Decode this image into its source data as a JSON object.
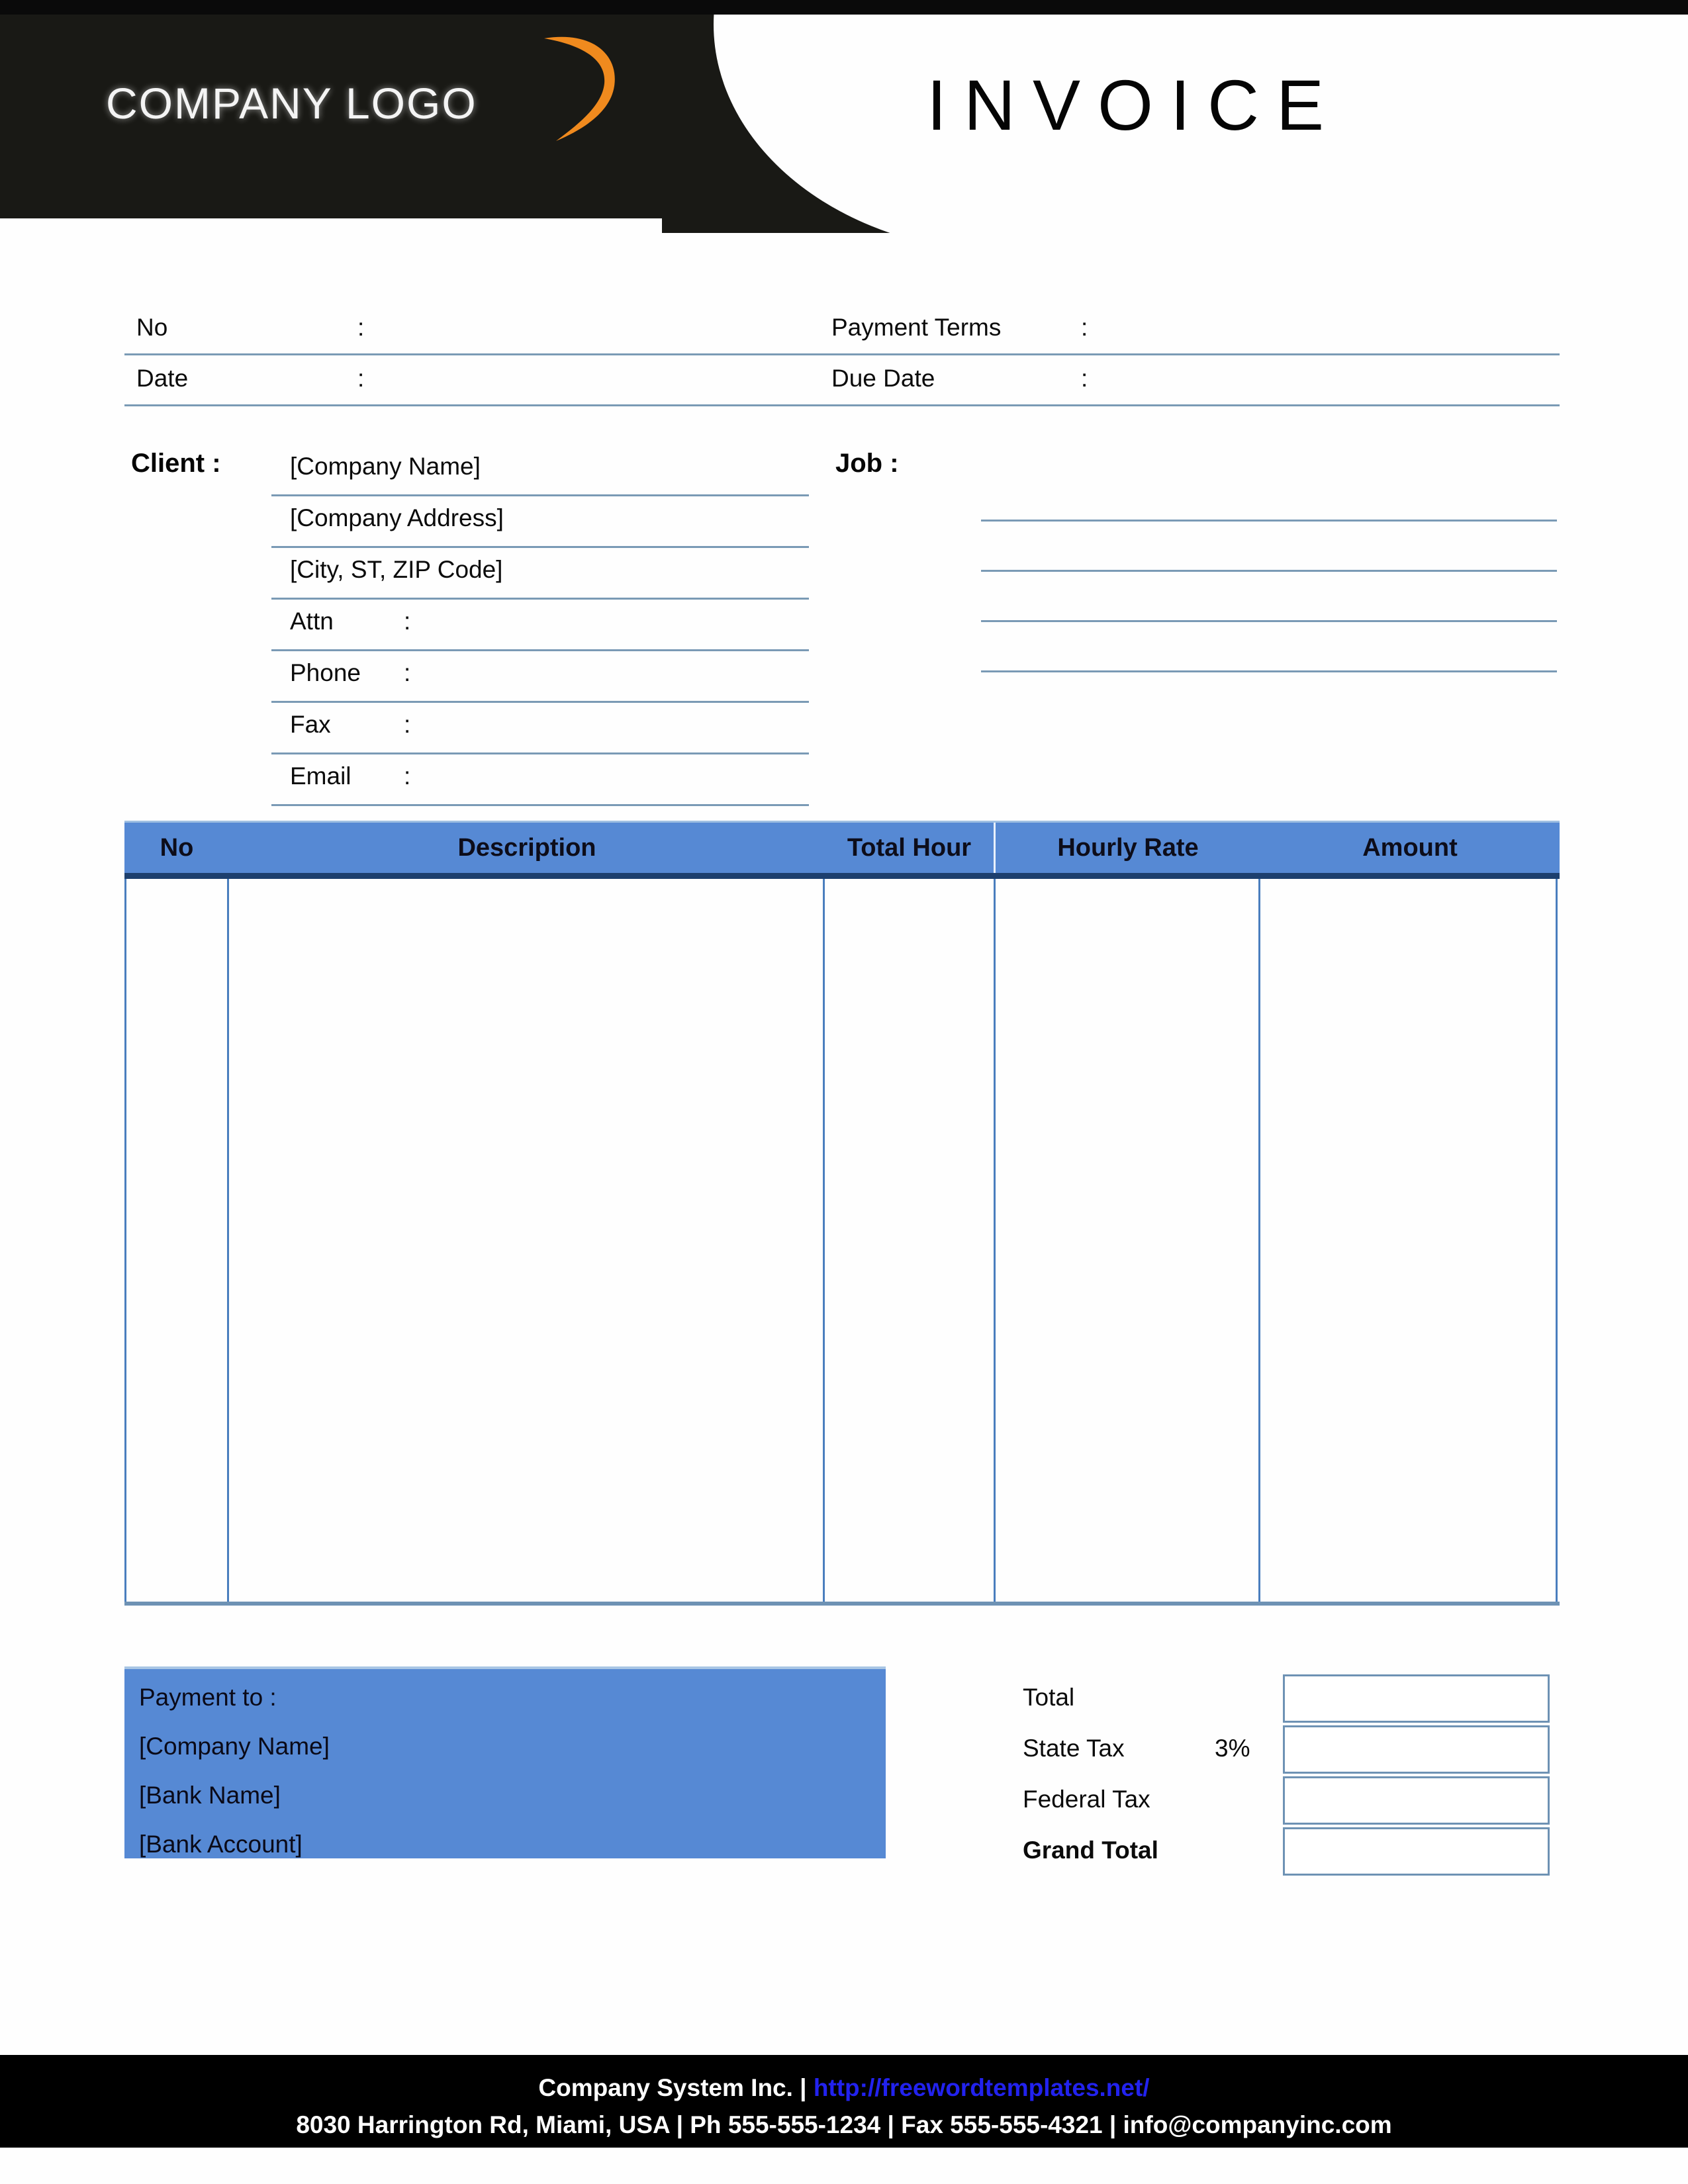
{
  "header": {
    "logo_text": "COMPANY LOGO",
    "logo_swoosh_color": "#F08A1E",
    "title": "INVOICE",
    "background_color": "#191915"
  },
  "meta": {
    "rows": [
      {
        "left_label": "No",
        "left_colon": ":",
        "right_label": "Payment  Terms",
        "right_colon": ":"
      },
      {
        "left_label": "Date",
        "left_colon": ":",
        "right_label": "Due Date",
        "right_colon": ":"
      }
    ]
  },
  "client": {
    "label": "Client  :",
    "lines": [
      {
        "text": "[Company Name]",
        "colon": ""
      },
      {
        "text": "[Company Address]",
        "colon": ""
      },
      {
        "text": "[City, ST, ZIP Code]",
        "colon": ""
      },
      {
        "text": "Attn",
        "colon": ":"
      },
      {
        "text": "Phone",
        "colon": ":"
      },
      {
        "text": "Fax",
        "colon": ":"
      },
      {
        "text": "Email",
        "colon": ":"
      }
    ]
  },
  "job": {
    "label": "Job  :",
    "blank_line_count": 4
  },
  "items_table": {
    "accent_color": "#5689D4",
    "columns": [
      "No",
      "Description",
      "Total Hour",
      "Hourly Rate",
      "Amount"
    ],
    "rows": []
  },
  "payment": {
    "heading": "Payment to :",
    "lines": [
      "[Company Name]",
      "[Bank Name]",
      "[Bank Account]"
    ],
    "background_color": "#5689D4"
  },
  "totals": {
    "rows": [
      {
        "label": "Total",
        "percent": "",
        "value": "",
        "bold": false
      },
      {
        "label": "State Tax",
        "percent": "3%",
        "value": "",
        "bold": false
      },
      {
        "label": "Federal Tax",
        "percent": "",
        "value": "",
        "bold": false
      },
      {
        "label": "Grand Total",
        "percent": "",
        "value": "",
        "bold": true
      }
    ]
  },
  "footer": {
    "company": "Company System Inc. | ",
    "url": "http://freewordtemplates.net/",
    "address": "8030 Harrington Rd, Miami, USA | Ph 555-555-1234 | Fax 555-555-4321 | info@companyinc.com",
    "link_color": "#2222EE"
  }
}
